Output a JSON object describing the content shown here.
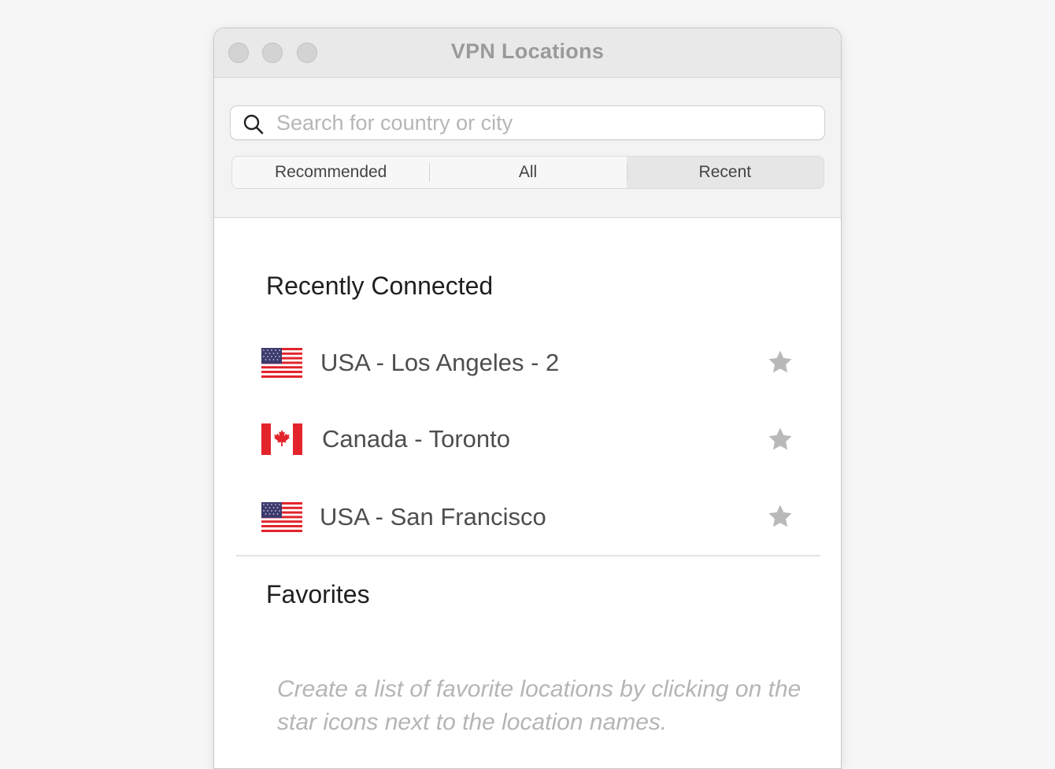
{
  "window": {
    "title": "VPN Locations"
  },
  "search": {
    "placeholder": "Search for country or city",
    "value": ""
  },
  "tabs": [
    {
      "label": "Recommended",
      "active": false
    },
    {
      "label": "All",
      "active": false
    },
    {
      "label": "Recent",
      "active": true
    }
  ],
  "recent": {
    "title": "Recently Connected",
    "items": [
      {
        "name": "USA - Los Angeles - 2",
        "flag": "us-flag-icon",
        "favorite": false
      },
      {
        "name": "Canada - Toronto",
        "flag": "canada-flag-icon",
        "favorite": false
      },
      {
        "name": "USA - San Francisco",
        "flag": "us-flag-icon",
        "favorite": false
      }
    ]
  },
  "favorites": {
    "title": "Favorites",
    "empty_hint": "Create a list of favorite locations by clicking on the star icons next to the location names."
  },
  "colors": {
    "background": "#f6f6f6",
    "titlebar": "#e9e9e9",
    "toolbar": "#f3f3f3",
    "star": "#b9b9b9",
    "flag_red": "#e3242b",
    "flag_blue": "#3c3b6e"
  },
  "icons": {
    "search": "search-icon",
    "star": "star-icon"
  }
}
